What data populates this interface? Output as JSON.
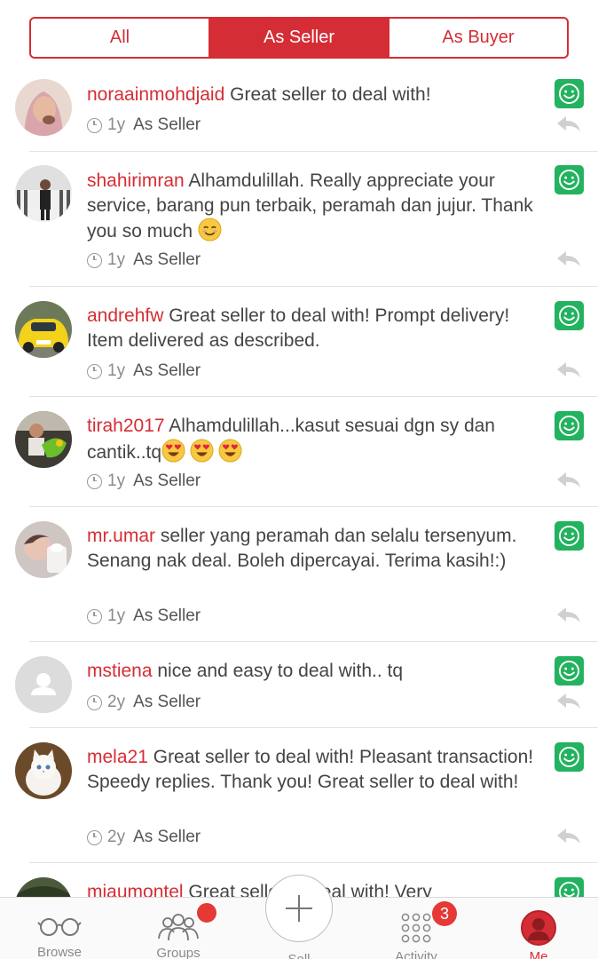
{
  "tabs": {
    "all": "All",
    "as_seller": "As Seller",
    "as_buyer": "As Buyer",
    "active": "as_seller"
  },
  "feedback": [
    {
      "username": "noraainmohdjaid",
      "message": "Great seller to deal with!",
      "age": "1y",
      "role": "As Seller"
    },
    {
      "username": "shahirimran",
      "message": "Alhamdulillah. Really appreciate your service, barang pun terbaik, peramah dan jujur. Thank you so much",
      "age": "1y",
      "role": "As Seller"
    },
    {
      "username": "andrehfw",
      "message": "Great seller to deal with! Prompt delivery! Item delivered as described.",
      "age": "1y",
      "role": "As Seller"
    },
    {
      "username": "tirah2017",
      "message": "Alhamdulillah...kasut sesuai dgn sy dan cantik..tq",
      "age": "1y",
      "role": "As Seller"
    },
    {
      "username": "mr.umar",
      "message": "seller yang peramah dan selalu tersenyum. Senang nak deal. Boleh dipercayai. Terima kasih!:)",
      "age": "1y",
      "role": "As Seller"
    },
    {
      "username": "mstiena",
      "message": "nice and easy to deal with.. tq",
      "age": "2y",
      "role": "As Seller"
    },
    {
      "username": "mela21",
      "message": "Great seller to deal with! Pleasant transaction! Speedy replies. Thank you! Great seller to deal with!",
      "age": "2y",
      "role": "As Seller"
    },
    {
      "username": "miaumontel",
      "message": "Great seller to deal with! Very",
      "age": "",
      "role": ""
    }
  ],
  "bottom_nav": {
    "browse": "Browse",
    "groups": "Groups",
    "sell": "Sell",
    "activity": "Activity",
    "activity_badge": "3",
    "me": "Me"
  },
  "colors": {
    "accent": "#d52d35",
    "positive": "#23b25f"
  }
}
